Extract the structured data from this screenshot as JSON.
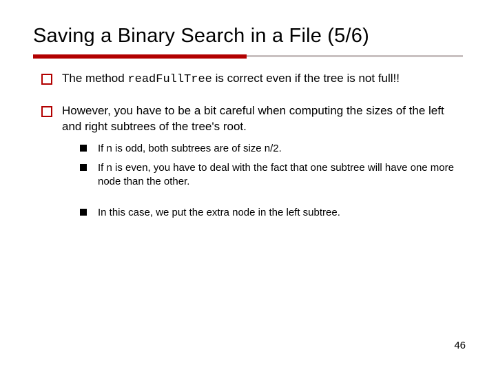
{
  "title": "Saving a Binary Search in a File (5/6)",
  "bullets": {
    "b1_pre": "The method ",
    "b1_code": "readFullTree",
    "b1_post": " is correct even if the tree is not full!!",
    "b2": "However, you have to be a bit careful when computing the sizes of the left and right subtrees of the tree's root.",
    "b2a": "If n is odd, both subtrees are of size n/2.",
    "b2b": "If n is even, you have to deal with the fact that one subtree will have one more node than the other.",
    "b2c": "In this case, we put the extra node in the left subtree."
  },
  "page_number": "46"
}
